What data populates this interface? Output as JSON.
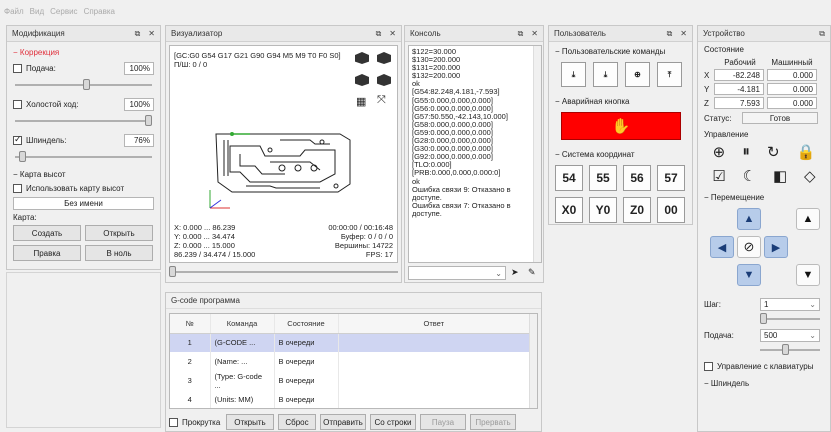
{
  "menu": [
    "Файл",
    "Вид",
    "Сервис",
    "Справка"
  ],
  "panels": {
    "modification": {
      "title": "Модификация",
      "correction_label": "Коррекция",
      "feed_label": "Подача:",
      "feed_value": "100%",
      "rapid_label": "Холостой ход:",
      "rapid_value": "100%",
      "spindle_label": "Шпиндель:",
      "spindle_value": "76%",
      "heightmap_section": "Карта высот",
      "use_heightmap_label": "Использовать карту высот",
      "map_name": "Без имени",
      "map_label": "Карта:",
      "create_label": "Создать",
      "open_label": "Открыть",
      "edit_label": "Правка",
      "zero_label": "В ноль"
    },
    "visualizer": {
      "title": "Визуализатор",
      "gcode_state": "[GC:G0 G54 G17 G21 G90 G94 M5 M9 T0 F0 S0]",
      "pass": "П/Ш: 0 / 0",
      "x_range": "X: 0.000 ... 86.239",
      "y_range": "Y: 0.000 ... 34.474",
      "z_range": "Z: 0.000 ... 15.000",
      "size": "86.239 / 34.474 / 15.000",
      "time": "00:00:00 / 00:16:48",
      "buffer": "Буфер: 0 / 0 / 0",
      "vertices": "Вершины: 14722",
      "fps": "FPS: 17"
    },
    "console": {
      "title": "Консоль",
      "lines": [
        "$122=30.000",
        "$130=200.000",
        "$131=200.000",
        "$132=200.000",
        "ok",
        "[G54:82.248,4.181,-7.593]",
        "[G55:0.000,0.000,0.000]",
        "[G56:0.000,0.000,0.000]",
        "[G57:50.550,-42.143,10.000]",
        "[G58:0.000,0.000,0.000]",
        "[G59:0.000,0.000,0.000]",
        "[G28:0.000,0.000,0.000]",
        "[G30:0.000,0.000,0.000]",
        "[G92:0.000,0.000,0.000]",
        "[TLO:0.000]",
        "[PRB:0.000,0.000,0.000:0]",
        "ok",
        "Ошибка связи 9: Отказано в",
        "доступе.",
        "Ошибка связи 7: Отказано в",
        "доступе."
      ]
    },
    "user": {
      "title": "Пользователь",
      "user_commands": "Пользовательские команды",
      "emergency": "Аварийная кнопка",
      "coord_system": "Система координат",
      "coord_buttons": [
        "54",
        "55",
        "56",
        "57"
      ],
      "zero_buttons": [
        "X0",
        "Y0",
        "Z0",
        "00"
      ],
      "emergency_color": "#ff0000"
    },
    "device": {
      "title": "Устройство",
      "state_label": "Состояние",
      "work_label": "Рабочий",
      "machine_label": "Машинный",
      "rows": [
        {
          "axis": "X",
          "work": "-82.248",
          "machine": "0.000"
        },
        {
          "axis": "Y",
          "work": "-4.181",
          "machine": "0.000"
        },
        {
          "axis": "Z",
          "work": "7.593",
          "machine": "0.000"
        }
      ],
      "status_label": "Статус:",
      "status_value": "Готов",
      "control_label": "Управление",
      "jog_label": "Перемещение",
      "step_label": "Шаг:",
      "step_value": "1",
      "feed_label": "Подача:",
      "feed_value": "500",
      "keyboard_label": "Управление с клавиатуры",
      "spindle_label": "Шпиндель"
    },
    "gcode": {
      "title": "G-code программа",
      "columns": [
        "№",
        "Команда",
        "Состояние",
        "Ответ"
      ],
      "rows": [
        {
          "n": "1",
          "cmd": "(G-CODE ...",
          "state": "В очереди",
          "resp": ""
        },
        {
          "n": "2",
          "cmd": "(Name: ...",
          "state": "В очереди",
          "resp": ""
        },
        {
          "n": "3",
          "cmd": "(Type: G-code ...",
          "state": "В очереди",
          "resp": ""
        },
        {
          "n": "4",
          "cmd": "(Units: MM)",
          "state": "В очереди",
          "resp": ""
        }
      ],
      "scroll_label": "Прокрутка",
      "open_label": "Открыть",
      "reset_label": "Сброс",
      "send_label": "Отправить",
      "from_line_label": "Со строки",
      "pause_label": "Пауза",
      "abort_label": "Прервать"
    }
  },
  "colors": {
    "accent_red": "#e0303c",
    "selection": "#cfd5f2",
    "nav_blue": "#b7ccea",
    "nav_icon": "#1a3d78"
  }
}
